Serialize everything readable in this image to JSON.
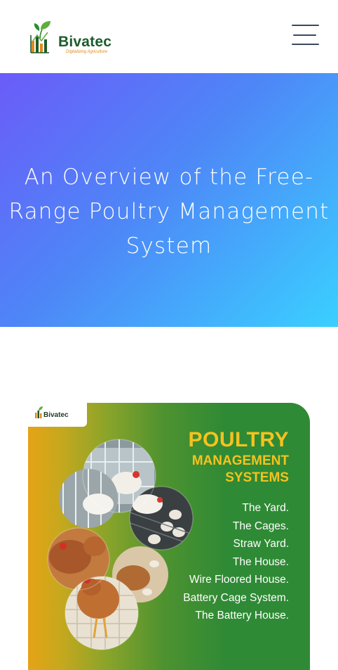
{
  "header": {
    "brand": "Bivatec",
    "tagline": "Digitalizing Agriculture",
    "menu_icon": "hamburger-menu-icon"
  },
  "hero": {
    "title": "An Overview of the Free-Range Poultry Management System",
    "gradient_start": "#6a5cf9",
    "gradient_end": "#3ad0ff"
  },
  "feature": {
    "logo_text": "Bivatec",
    "heading": "POULTRY",
    "subheading_1": "MANAGEMENT",
    "subheading_2": "SYSTEMS",
    "accent_color": "#f6c21e",
    "items": [
      "The Yard.",
      "The Cages.",
      "Straw Yard.",
      "The House.",
      "Wire Floored House.",
      "Battery Cage System.",
      "The Battery House."
    ]
  }
}
